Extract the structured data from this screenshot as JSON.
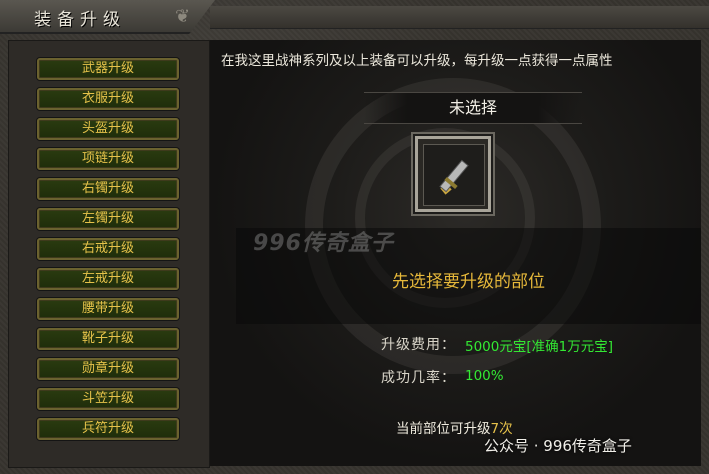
{
  "window": {
    "title": "装备升级"
  },
  "sidebar": {
    "items": [
      {
        "label": "武器升级"
      },
      {
        "label": "衣服升级"
      },
      {
        "label": "头盔升级"
      },
      {
        "label": "项链升级"
      },
      {
        "label": "右镯升级"
      },
      {
        "label": "左镯升级"
      },
      {
        "label": "右戒升级"
      },
      {
        "label": "左戒升级"
      },
      {
        "label": "腰带升级"
      },
      {
        "label": "靴子升级"
      },
      {
        "label": "勋章升级"
      },
      {
        "label": "斗笠升级"
      },
      {
        "label": "兵符升级"
      }
    ]
  },
  "main": {
    "headline": "在我这里战神系列及以上装备可以升级，每升级一点获得一点属性",
    "slot_title": "未选择",
    "notice": "先选择要升级的部位",
    "cost_label": "升级费用：",
    "cost_value": "5000元宝[准确1万元宝]",
    "rate_label": "成功几率：",
    "rate_value": "100%",
    "footer_prefix": "当前部位可升级",
    "footer_count": "7次"
  },
  "overlay": {
    "watermark": "996传奇盒子",
    "credit": "公众号 · 996传奇盒子"
  },
  "colors": {
    "accent_gold": "#e6c24a",
    "value_green": "#33e833",
    "notice_orange": "#e6b83a"
  }
}
